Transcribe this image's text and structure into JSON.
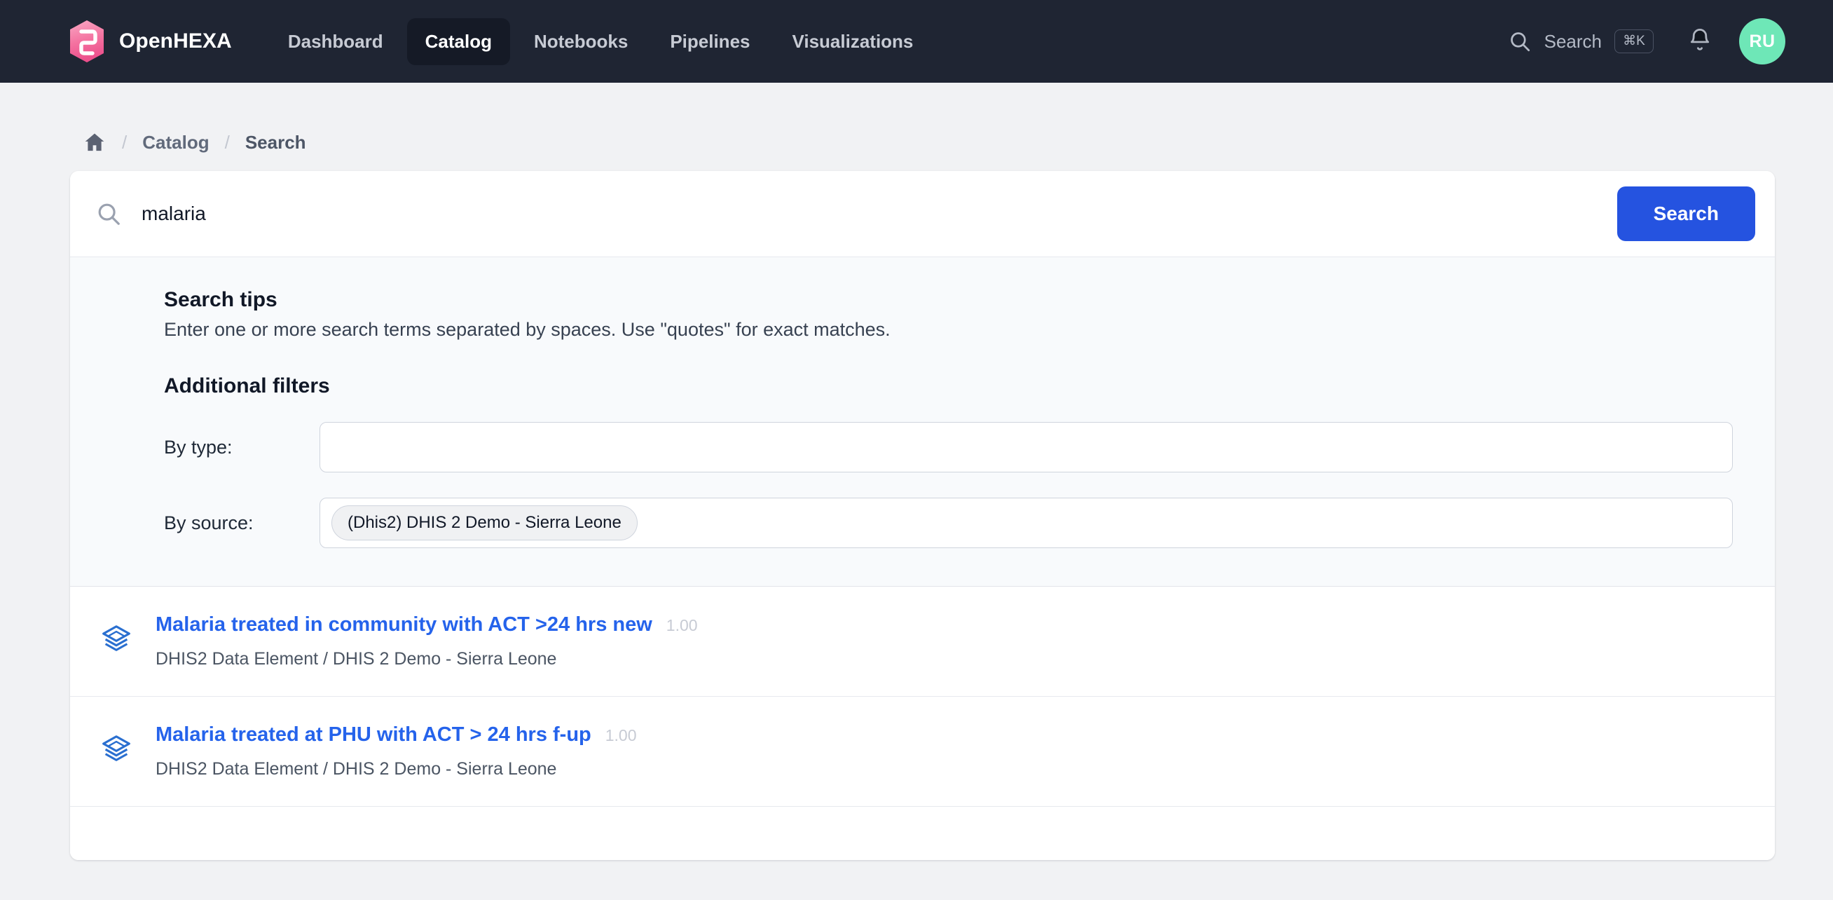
{
  "navbar": {
    "brand": "OpenHEXA",
    "logo_icon": "openhexa-hexagon-logo",
    "links": [
      {
        "label": "Dashboard",
        "active": false
      },
      {
        "label": "Catalog",
        "active": true
      },
      {
        "label": "Notebooks",
        "active": false
      },
      {
        "label": "Pipelines",
        "active": false
      },
      {
        "label": "Visualizations",
        "active": false
      }
    ],
    "search": {
      "icon": "search-icon",
      "label": "Search",
      "shortcut": "⌘K"
    },
    "notifications_icon": "bell-icon",
    "avatar_initials": "RU",
    "avatar_color": "#6ee7b7",
    "background_color": "#1f2533"
  },
  "breadcrumb": {
    "home_icon": "home-icon",
    "separator": "/",
    "items": [
      {
        "label": "Catalog"
      },
      {
        "label": "Search"
      }
    ]
  },
  "search_card": {
    "icon": "search-icon",
    "query": "malaria",
    "placeholder": "Search",
    "button_label": "Search",
    "button_color": "#2553e0"
  },
  "tips": {
    "title": "Search tips",
    "text": "Enter one or more search terms separated by spaces. Use \"quotes\" for exact matches.",
    "filters_title": "Additional filters",
    "filters": [
      {
        "label": "By type:",
        "value": "",
        "chips": []
      },
      {
        "label": "By source:",
        "value": "",
        "chips": [
          "(Dhis2) DHIS 2 Demo - Sierra Leone"
        ]
      }
    ]
  },
  "results": [
    {
      "icon": "layers-icon",
      "title": "Malaria treated in community with ACT >24 hrs new",
      "score": "1.00",
      "subtitle": "DHIS2 Data Element / DHIS 2 Demo - Sierra Leone"
    },
    {
      "icon": "layers-icon",
      "title": "Malaria treated at PHU with ACT > 24 hrs f-up",
      "score": "1.00",
      "subtitle": "DHIS2 Data Element / DHIS 2 Demo - Sierra Leone"
    },
    {
      "icon": "layers-icon",
      "title": "",
      "score": "",
      "subtitle": ""
    }
  ]
}
